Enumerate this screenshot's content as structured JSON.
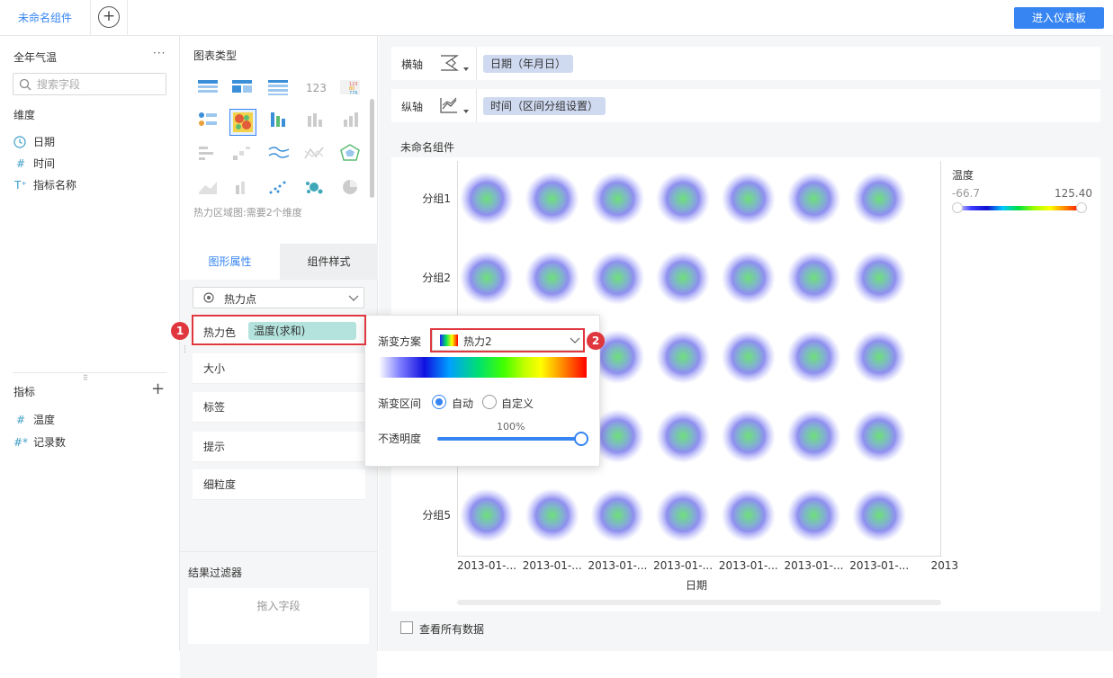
{
  "topbar": {
    "tab_label": "未命名组件",
    "add_tab": "+",
    "dashboard_button": "进入仪表板"
  },
  "left": {
    "dataset_title": "全年气温",
    "more": "···",
    "search_placeholder": "搜索字段",
    "dimensions_title": "维度",
    "dimensions": [
      {
        "icon": "clock-icon",
        "label": "日期"
      },
      {
        "icon": "hash-icon",
        "label": "时间"
      },
      {
        "icon": "text-type-icon",
        "label": "指标名称"
      }
    ],
    "measures_title": "指标",
    "measures": [
      {
        "icon": "hash-icon",
        "label": "温度"
      },
      {
        "icon": "hash-star-icon",
        "label": "记录数"
      }
    ]
  },
  "middle": {
    "chart_type_title": "图表类型",
    "chart_hint": "热力区域图:需要2个维度",
    "tab_graph_props": "图形属性",
    "tab_component_style": "组件样式",
    "mark_type": "热力点",
    "heat_color_label": "热力色",
    "heat_color_field": "温度(求和)",
    "props": [
      "大小",
      "标签",
      "提示",
      "细粒度"
    ],
    "filter_title": "结果过滤器",
    "filter_drop": "拖入字段"
  },
  "axes": {
    "x_label": "横轴",
    "x_field": "日期（年月日）",
    "y_label": "纵轴",
    "y_field": "时间（区间分组设置）"
  },
  "chart": {
    "title": "未命名组件",
    "legend_title": "温度",
    "legend_min": "-66.7",
    "legend_max": "125.40",
    "xlabel": "日期",
    "show_all_data": "查看所有数据"
  },
  "popup": {
    "gradient_label": "渐变方案",
    "gradient_value": "热力2",
    "range_label": "渐变区间",
    "range_auto": "自动",
    "range_custom": "自定义",
    "opacity_label": "不透明度",
    "opacity_value": "100%",
    "opacity": 1.0
  },
  "badges": {
    "one": "1",
    "two": "2"
  },
  "colors": {
    "accent": "#3685f2",
    "highlight": "#e0373f",
    "pill": "#cfdaf0",
    "heat_pill": "#b3e3dc"
  },
  "chart_data": {
    "type": "heatmap",
    "title": "未命名组件",
    "xlabel": "日期",
    "ylabel": "",
    "x": [
      "2013-01-...",
      "2013-01-...",
      "2013-01-...",
      "2013-01-...",
      "2013-01-...",
      "2013-01-...",
      "2013-01-...",
      "2013"
    ],
    "y": [
      "分组1",
      "分组2",
      "",
      "",
      "分组5"
    ],
    "legend": {
      "title": "温度",
      "min": -66.7,
      "max": 125.4
    }
  }
}
